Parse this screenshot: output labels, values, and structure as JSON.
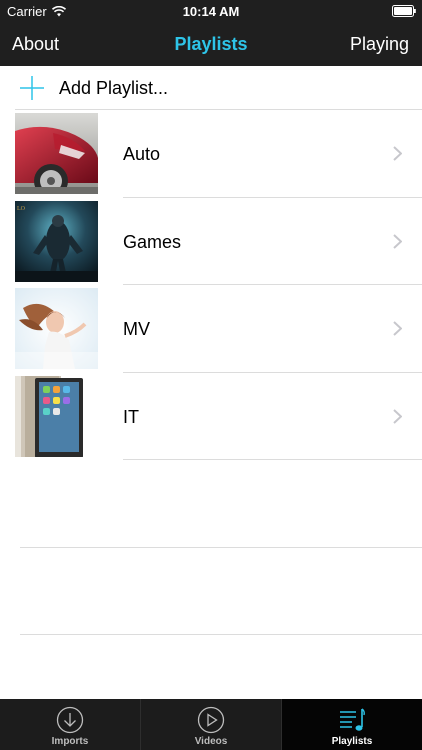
{
  "status_bar": {
    "carrier": "Carrier",
    "time": "10:14 AM",
    "wifi_icon": "wifi-icon",
    "battery_icon": "battery-icon"
  },
  "nav": {
    "left_button": "About",
    "title": "Playlists",
    "right_button": "Playing",
    "title_color": "#2ec4e8"
  },
  "add_playlist": {
    "label": "Add Playlist...",
    "icon": "plus-icon",
    "icon_color": "#2ec4e8"
  },
  "playlists": [
    {
      "label": "Auto",
      "thumbnail": "red car photo"
    },
    {
      "label": "Games",
      "thumbnail": "game warrior artwork"
    },
    {
      "label": "MV",
      "thumbnail": "woman with flowing hair"
    },
    {
      "label": "IT",
      "thumbnail": "smartphone close-up"
    }
  ],
  "tab_bar": {
    "tabs": [
      {
        "label": "Imports",
        "icon": "download-circle-icon",
        "active": false
      },
      {
        "label": "Videos",
        "icon": "play-circle-icon",
        "active": false
      },
      {
        "label": "Playlists",
        "icon": "playlist-music-icon",
        "active": true
      }
    ],
    "active_color": "#2ec4e8"
  }
}
